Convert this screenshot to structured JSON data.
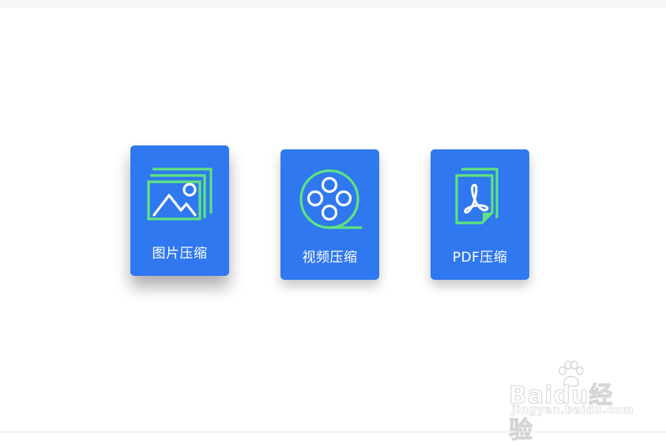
{
  "cards": [
    {
      "label": "图片压缩",
      "icon": "image-icon",
      "state": "hover"
    },
    {
      "label": "视频压缩",
      "icon": "film-reel-icon",
      "state": "normal"
    },
    {
      "label": "PDF压缩",
      "icon": "pdf-file-icon",
      "state": "normal"
    }
  ],
  "colors": {
    "card_background": "#2f78ef",
    "icon_green": "#5fe37e",
    "icon_white": "#ffffff",
    "page_background": "#ffffff"
  },
  "watermark": {
    "brand": "Baidu经验",
    "url": "jingyan.baidu.com",
    "icon": "paw-icon"
  }
}
